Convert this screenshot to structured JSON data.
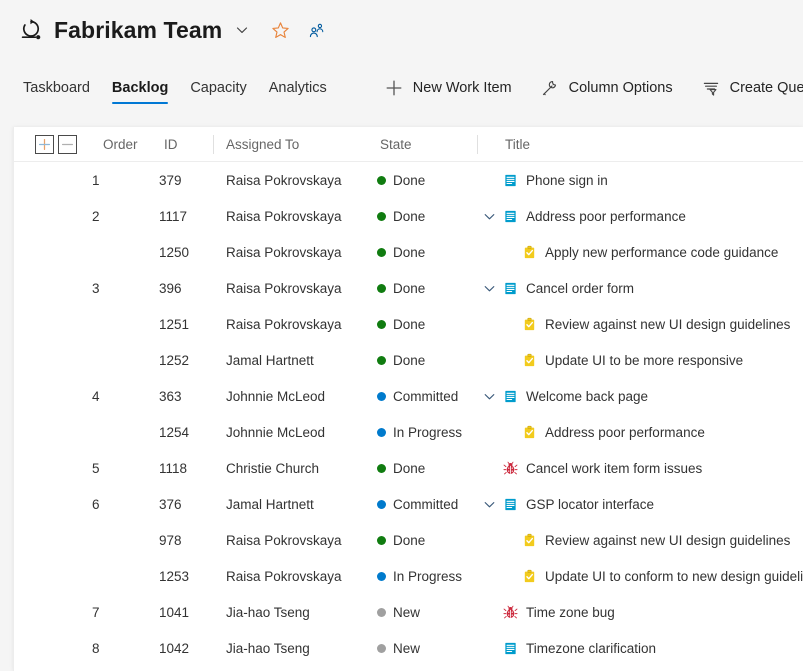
{
  "header": {
    "team_icon": "sprint-icon",
    "title": "Fabrikam Team",
    "chevron_icon": "chevron-down-icon",
    "favorite_icon": "star-icon",
    "team_members_icon": "people-icon",
    "star_color": "#e8833a",
    "people_color": "#005a9e"
  },
  "toolbar": {
    "tabs": [
      {
        "label": "Taskboard",
        "active": false
      },
      {
        "label": "Backlog",
        "active": true
      },
      {
        "label": "Capacity",
        "active": false
      },
      {
        "label": "Analytics",
        "active": false
      }
    ],
    "actions": [
      {
        "label": "New Work Item",
        "icon": "plus-icon"
      },
      {
        "label": "Column Options",
        "icon": "wrench-icon"
      },
      {
        "label": "Create Query",
        "icon": "filter-icon"
      }
    ],
    "active_tab_color": "#0078d4"
  },
  "grid": {
    "expand_button": {
      "icon": "plus-icon",
      "label": "+"
    },
    "collapse_button": {
      "icon": "minus-icon",
      "label": "–"
    },
    "columns": [
      {
        "key": "order",
        "label": "Order"
      },
      {
        "key": "id",
        "label": "ID"
      },
      {
        "key": "assigned_to",
        "label": "Assigned To"
      },
      {
        "key": "state",
        "label": "State"
      },
      {
        "key": "title",
        "label": "Title"
      }
    ],
    "state_colors": {
      "Done": "#107c10",
      "Committed": "#007acc",
      "In Progress": "#007acc",
      "New": "#a0a0a0"
    },
    "type_colors": {
      "User Story": "#009ccc",
      "Task": "#f2cb1d",
      "Bug": "#cc293d"
    },
    "rows": [
      {
        "order": "1",
        "id": "379",
        "assigned_to": "Raisa Pokrovskaya",
        "state": "Done",
        "title": "Phone sign in",
        "type": "User Story",
        "child": false,
        "expandable": false
      },
      {
        "order": "2",
        "id": "1117",
        "assigned_to": "Raisa Pokrovskaya",
        "state": "Done",
        "title": "Address poor performance",
        "type": "User Story",
        "child": false,
        "expandable": true
      },
      {
        "order": "",
        "id": "1250",
        "assigned_to": "Raisa Pokrovskaya",
        "state": "Done",
        "title": "Apply new performance code guidance",
        "type": "Task",
        "child": true,
        "expandable": false
      },
      {
        "order": "3",
        "id": "396",
        "assigned_to": "Raisa Pokrovskaya",
        "state": "Done",
        "title": "Cancel order form",
        "type": "User Story",
        "child": false,
        "expandable": true
      },
      {
        "order": "",
        "id": "1251",
        "assigned_to": "Raisa Pokrovskaya",
        "state": "Done",
        "title": "Review against new UI design guidelines",
        "type": "Task",
        "child": true,
        "expandable": false
      },
      {
        "order": "",
        "id": "1252",
        "assigned_to": "Jamal Hartnett",
        "state": "Done",
        "title": "Update UI to be more responsive",
        "type": "Task",
        "child": true,
        "expandable": false
      },
      {
        "order": "4",
        "id": "363",
        "assigned_to": "Johnnie McLeod",
        "state": "Committed",
        "title": "Welcome back page",
        "type": "User Story",
        "child": false,
        "expandable": true
      },
      {
        "order": "",
        "id": "1254",
        "assigned_to": "Johnnie McLeod",
        "state": "In Progress",
        "title": "Address poor performance",
        "type": "Task",
        "child": true,
        "expandable": false
      },
      {
        "order": "5",
        "id": "1118",
        "assigned_to": "Christie Church",
        "state": "Done",
        "title": "Cancel work item form issues",
        "type": "Bug",
        "child": false,
        "expandable": false
      },
      {
        "order": "6",
        "id": "376",
        "assigned_to": "Jamal Hartnett",
        "state": "Committed",
        "title": "GSP locator interface",
        "type": "User Story",
        "child": false,
        "expandable": true
      },
      {
        "order": "",
        "id": "978",
        "assigned_to": "Raisa Pokrovskaya",
        "state": "Done",
        "title": "Review against new UI design guidelines",
        "type": "Task",
        "child": true,
        "expandable": false
      },
      {
        "order": "",
        "id": "1253",
        "assigned_to": "Raisa Pokrovskaya",
        "state": "In Progress",
        "title": "Update UI to conform to new design guidelines",
        "type": "Task",
        "child": true,
        "expandable": false
      },
      {
        "order": "7",
        "id": "1041",
        "assigned_to": "Jia-hao Tseng",
        "state": "New",
        "title": "Time zone bug",
        "type": "Bug",
        "child": false,
        "expandable": false
      },
      {
        "order": "8",
        "id": "1042",
        "assigned_to": "Jia-hao Tseng",
        "state": "New",
        "title": "Timezone clarification",
        "type": "User Story",
        "child": false,
        "expandable": false
      }
    ]
  }
}
